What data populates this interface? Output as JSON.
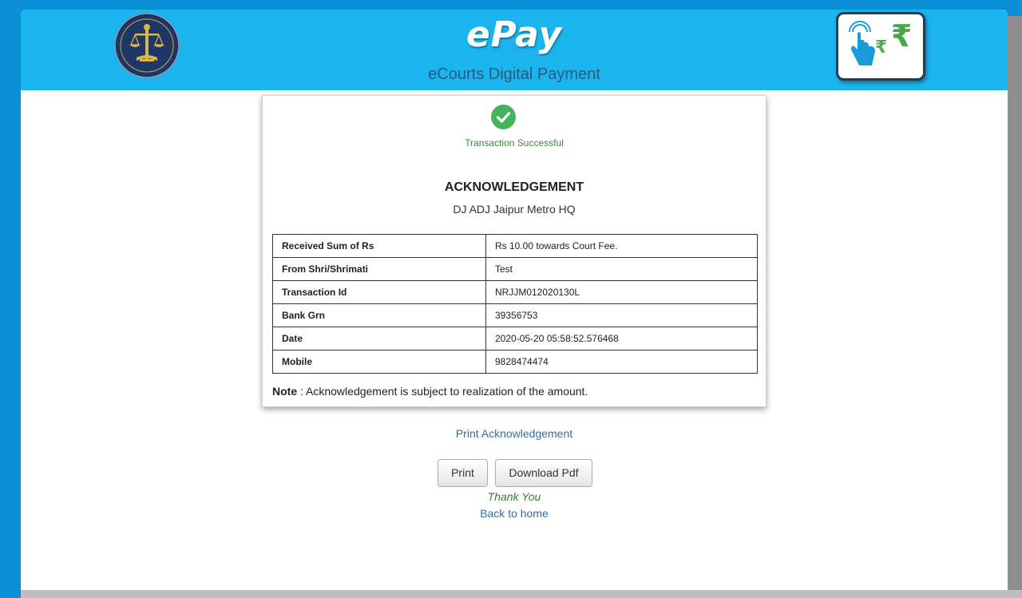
{
  "header": {
    "brand": "ePay",
    "subtitle": "eCourts Digital Payment",
    "emblem_icon": "ecourts-emblem-icon",
    "logo_icon": "tap-to-pay-rupee-icon",
    "colors": {
      "header_bg": "#1ab5ee",
      "page_bg": "#0a8fd6"
    }
  },
  "receipt": {
    "status_icon": "check-circle-icon",
    "status_text": "Transaction Successful",
    "title": "ACKNOWLEDGEMENT",
    "court": "DJ ADJ Jaipur Metro HQ",
    "rows": [
      {
        "label": "Received Sum of Rs",
        "value": "Rs 10.00 towards Court Fee."
      },
      {
        "label": "From Shri/Shrimati",
        "value": "Test"
      },
      {
        "label": "Transaction Id",
        "value": "NRJJM012020130L"
      },
      {
        "label": "Bank Grn",
        "value": "39356753"
      },
      {
        "label": "Date",
        "value": "2020-05-20 05:58:52.576468"
      },
      {
        "label": "Mobile",
        "value": "9828474474"
      }
    ],
    "note_label": "Note",
    "note_text": " : Acknowledgement is subject to realization of the amount."
  },
  "actions": {
    "print_ack_link": "Print Acknowledgement",
    "print_button": "Print",
    "download_button": "Download Pdf",
    "thank_you": "Thank You",
    "back_home_link": "Back to home"
  }
}
